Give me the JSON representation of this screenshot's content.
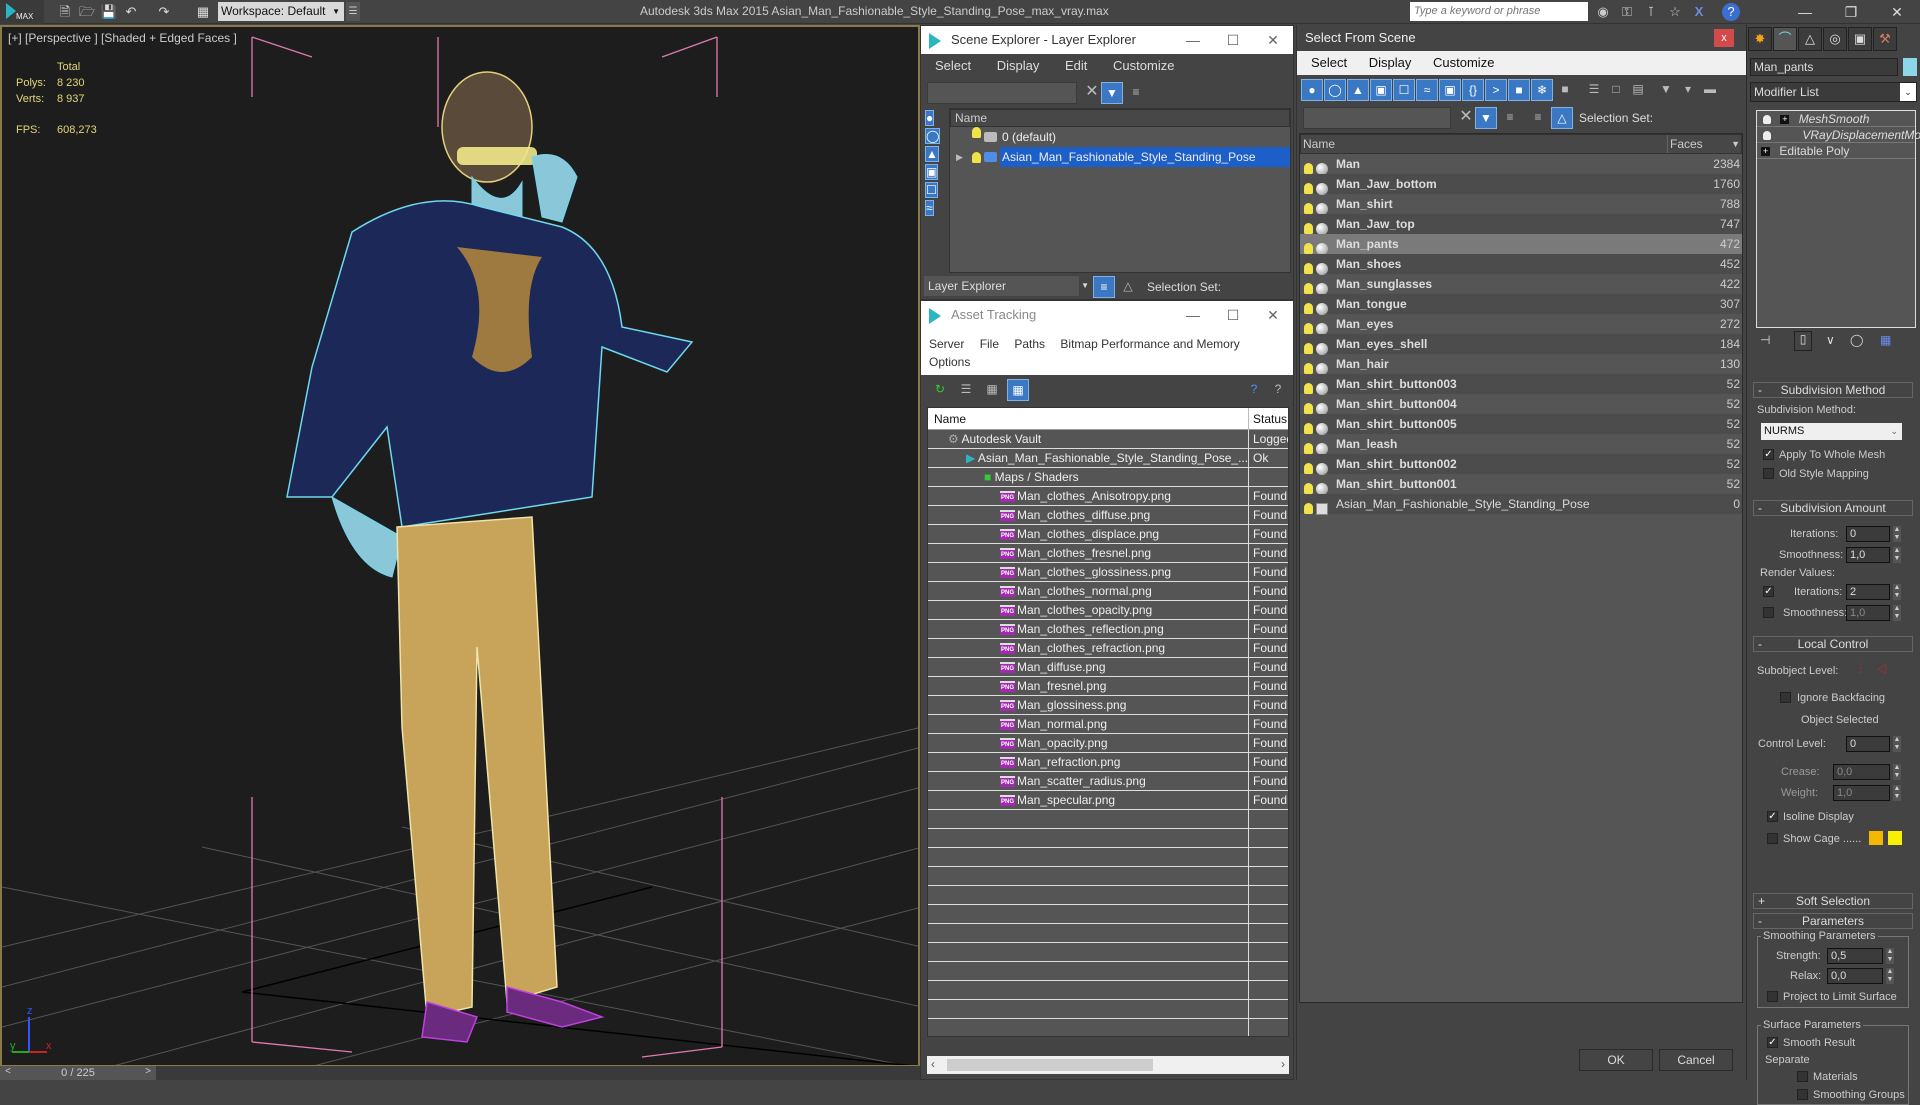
{
  "app": {
    "logo_label": "MAX",
    "workspace": "Workspace: Default",
    "title": "Autodesk 3ds Max  2015    Asian_Man_Fashionable_Style_Standing_Pose_max_vray.max",
    "search_placeholder": "Type a keyword or phrase",
    "toolbar_icons": [
      "new-file-icon",
      "open-file-icon",
      "save-icon",
      "undo-icon",
      "redo-icon",
      "project-icon"
    ],
    "info_icons": [
      "binoculars-icon",
      "key-icon",
      "satellite-icon",
      "star-icon",
      "x-icon",
      "help-icon"
    ],
    "window_controls": [
      "minimize",
      "restore",
      "close"
    ]
  },
  "viewport": {
    "label": "[+] [Perspective ] [Shaded + Edged Faces ]",
    "stats": {
      "header": "Total",
      "polys_label": "Polys:",
      "polys_value": "8 230",
      "verts_label": "Verts:",
      "verts_value": "8 937",
      "fps_label": "FPS:",
      "fps_value": "608,273"
    },
    "axis": {
      "x": "x",
      "y": "y",
      "z": "z"
    },
    "time_slider": {
      "value": "0 / 225",
      "prev": "<",
      "next": ">"
    }
  },
  "scene_explorer": {
    "title": "Scene Explorer - Layer Explorer",
    "menu": [
      "Select",
      "Display",
      "Edit",
      "Customize"
    ],
    "column_name": "Name",
    "layers": [
      {
        "name": "0 (default)",
        "selected": false,
        "expandable": false
      },
      {
        "name": "Asian_Man_Fashionable_Style_Standing_Pose",
        "selected": true,
        "expandable": true
      }
    ],
    "explorer_dropdown": "Layer Explorer",
    "selection_set_label": "Selection Set:"
  },
  "asset_tracking": {
    "title": "Asset Tracking",
    "menu": [
      "Server",
      "File",
      "Paths",
      "Bitmap Performance and Memory",
      "Options"
    ],
    "columns": [
      "Name",
      "Status"
    ],
    "rows": [
      {
        "name": "Autodesk Vault",
        "status": "Logged",
        "level": 1,
        "icon": "vault-icon"
      },
      {
        "name": "Asian_Man_Fashionable_Style_Standing_Pose_...",
        "status": "Ok",
        "level": 2,
        "icon": "max-file-icon"
      },
      {
        "name": "Maps / Shaders",
        "status": "",
        "level": 3,
        "icon": "maps-icon"
      },
      {
        "name": "Man_clothes_Anisotropy.png",
        "status": "Found",
        "level": 4,
        "icon": "png-icon"
      },
      {
        "name": "Man_clothes_diffuse.png",
        "status": "Found",
        "level": 4,
        "icon": "png-icon"
      },
      {
        "name": "Man_clothes_displace.png",
        "status": "Found",
        "level": 4,
        "icon": "png-icon"
      },
      {
        "name": "Man_clothes_fresnel.png",
        "status": "Found",
        "level": 4,
        "icon": "png-icon"
      },
      {
        "name": "Man_clothes_glossiness.png",
        "status": "Found",
        "level": 4,
        "icon": "png-icon"
      },
      {
        "name": "Man_clothes_normal.png",
        "status": "Found",
        "level": 4,
        "icon": "png-icon"
      },
      {
        "name": "Man_clothes_opacity.png",
        "status": "Found",
        "level": 4,
        "icon": "png-icon"
      },
      {
        "name": "Man_clothes_reflection.png",
        "status": "Found",
        "level": 4,
        "icon": "png-icon"
      },
      {
        "name": "Man_clothes_refraction.png",
        "status": "Found",
        "level": 4,
        "icon": "png-icon"
      },
      {
        "name": "Man_diffuse.png",
        "status": "Found",
        "level": 4,
        "icon": "png-icon"
      },
      {
        "name": "Man_fresnel.png",
        "status": "Found",
        "level": 4,
        "icon": "png-icon"
      },
      {
        "name": "Man_glossiness.png",
        "status": "Found",
        "level": 4,
        "icon": "png-icon"
      },
      {
        "name": "Man_normal.png",
        "status": "Found",
        "level": 4,
        "icon": "png-icon"
      },
      {
        "name": "Man_opacity.png",
        "status": "Found",
        "level": 4,
        "icon": "png-icon"
      },
      {
        "name": "Man_refraction.png",
        "status": "Found",
        "level": 4,
        "icon": "png-icon"
      },
      {
        "name": "Man_scatter_radius.png",
        "status": "Found",
        "level": 4,
        "icon": "png-icon"
      },
      {
        "name": "Man_specular.png",
        "status": "Found",
        "level": 4,
        "icon": "png-icon"
      }
    ]
  },
  "select_from_scene": {
    "title": "Select From Scene",
    "close": "x",
    "menu": [
      "Select",
      "Display",
      "Customize"
    ],
    "selection_set_label": "Selection Set:",
    "columns": [
      "Name",
      "Faces"
    ],
    "rows": [
      {
        "name": "Man",
        "faces": "2384",
        "type": "geometry"
      },
      {
        "name": "Man_Jaw_bottom",
        "faces": "1760",
        "type": "geometry"
      },
      {
        "name": "Man_shirt",
        "faces": "788",
        "type": "geometry"
      },
      {
        "name": "Man_Jaw_top",
        "faces": "747",
        "type": "geometry"
      },
      {
        "name": "Man_pants",
        "faces": "472",
        "type": "geometry",
        "selected": true
      },
      {
        "name": "Man_shoes",
        "faces": "452",
        "type": "geometry"
      },
      {
        "name": "Man_sunglasses",
        "faces": "422",
        "type": "geometry"
      },
      {
        "name": "Man_tongue",
        "faces": "307",
        "type": "geometry"
      },
      {
        "name": "Man_eyes",
        "faces": "272",
        "type": "geometry"
      },
      {
        "name": "Man_eyes_shell",
        "faces": "184",
        "type": "geometry"
      },
      {
        "name": "Man_hair",
        "faces": "130",
        "type": "geometry"
      },
      {
        "name": "Man_shirt_button003",
        "faces": "52",
        "type": "geometry"
      },
      {
        "name": "Man_shirt_button004",
        "faces": "52",
        "type": "geometry"
      },
      {
        "name": "Man_shirt_button005",
        "faces": "52",
        "type": "geometry"
      },
      {
        "name": "Man_leash",
        "faces": "52",
        "type": "geometry"
      },
      {
        "name": "Man_shirt_button002",
        "faces": "52",
        "type": "geometry"
      },
      {
        "name": "Man_shirt_button001",
        "faces": "52",
        "type": "geometry"
      },
      {
        "name": "Asian_Man_Fashionable_Style_Standing_Pose",
        "faces": "0",
        "type": "group"
      }
    ],
    "ok_label": "OK",
    "cancel_label": "Cancel"
  },
  "command_panel": {
    "object_name": "Man_pants",
    "object_color": "#8cd8ea",
    "modifier_list": "Modifier List",
    "stack": [
      {
        "name": "MeshSmooth",
        "italic": true
      },
      {
        "name": "VRayDisplacementMod",
        "italic": true
      },
      {
        "name": "Editable Poly",
        "italic": false
      }
    ],
    "subdivision_method": {
      "title": "Subdivision Method",
      "label": "Subdivision Method:",
      "value": "NURMS",
      "apply_whole_mesh": "Apply To Whole Mesh",
      "apply_whole_mesh_checked": true,
      "old_style_mapping": "Old Style Mapping",
      "old_style_mapping_checked": false
    },
    "subdivision_amount": {
      "title": "Subdivision Amount",
      "iterations_label": "Iterations:",
      "iterations": "0",
      "smoothness_label": "Smoothness:",
      "smoothness": "1,0",
      "render_values_label": "Render Values:",
      "render_iterations_label": "Iterations:",
      "render_iterations": "2",
      "render_iterations_checked": true,
      "render_smoothness_label": "Smoothness:",
      "render_smoothness": "1,0",
      "render_smoothness_checked": false
    },
    "local_control": {
      "title": "Local Control",
      "subobject_label": "Subobject Level:",
      "ignore_backfacing": "Ignore Backfacing",
      "ignore_backfacing_checked": false,
      "object_selected": "Object Selected",
      "control_level_label": "Control Level:",
      "control_level": "0",
      "crease_label": "Crease:",
      "crease": "0,0",
      "weight_label": "Weight:",
      "weight": "1,0",
      "isoline_display": "Isoline Display",
      "isoline_checked": true,
      "show_cage": "Show Cage ......",
      "show_cage_checked": false,
      "cage_colors": [
        "#f5b800",
        "#f7f000"
      ]
    },
    "soft_selection": {
      "title": "Soft Selection"
    },
    "parameters": {
      "title": "Parameters",
      "smoothing_group": "Smoothing Parameters",
      "strength_label": "Strength:",
      "strength": "0,5",
      "relax_label": "Relax:",
      "relax": "0,0",
      "project_limit": "Project to Limit Surface",
      "project_limit_checked": false,
      "surface_group": "Surface Parameters",
      "smooth_result": "Smooth Result",
      "smooth_result_checked": true,
      "separate_label": "Separate",
      "materials": "Materials",
      "materials_checked": false,
      "smoothing_groups": "Smoothing Groups",
      "smoothing_groups_checked": false
    }
  }
}
